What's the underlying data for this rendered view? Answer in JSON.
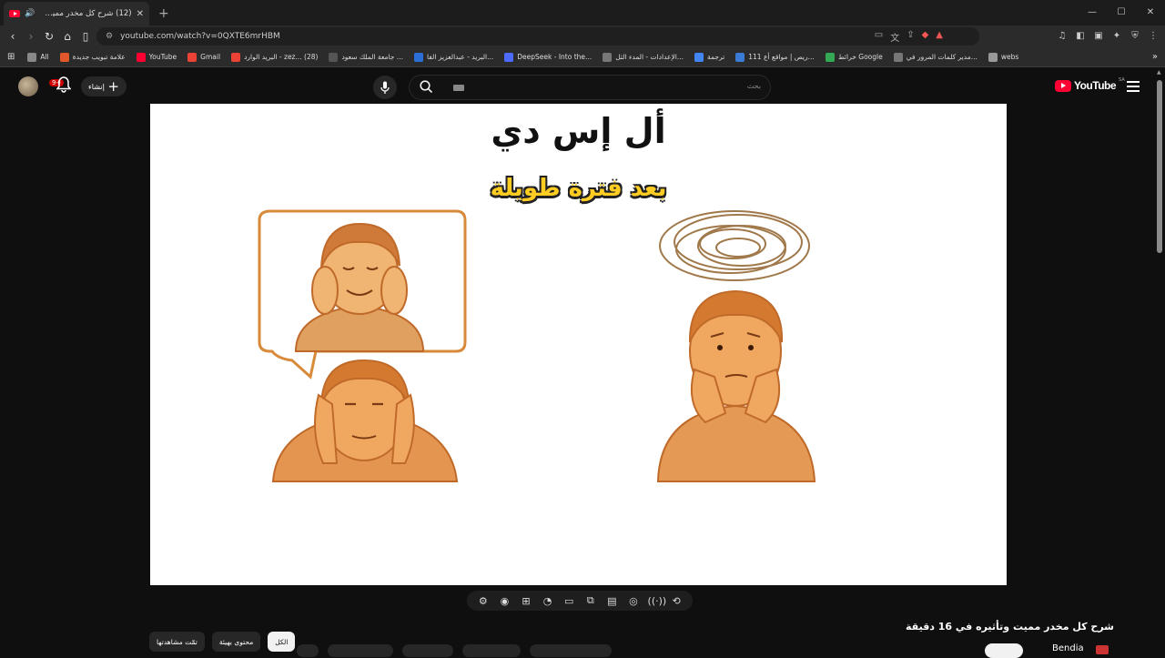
{
  "browser": {
    "tab_title": "(12) شرح كل مخدر مميت وتأثير...",
    "new_tab": "+",
    "url": "youtube.com/watch?v=0QXTE6mrHBM",
    "window_controls": [
      "—",
      "☐",
      "✕"
    ]
  },
  "bookmarks": [
    {
      "label": "All",
      "color": "#888888"
    },
    {
      "label": "علامة تبويب جديدة",
      "color": "#e0572b"
    },
    {
      "label": "YouTube",
      "color": "#ff0033"
    },
    {
      "label": "Gmail",
      "color": "#ea4335"
    },
    {
      "label": "البريد الوارد - zez... (28)",
      "color": "#ea4335"
    },
    {
      "label": "جامعة الملك سعود ...",
      "color": "#555555"
    },
    {
      "label": "البريد - عبدالعزيز الفا...",
      "color": "#2b6fd6"
    },
    {
      "label": "DeepSeek - Into the...",
      "color": "#4d6bfe"
    },
    {
      "label": "الإعدادات - المدء الثل...",
      "color": "#777777"
    },
    {
      "label": "ترجمة",
      "color": "#4285f4"
    },
    {
      "label": "111 ريص | مواقع أع...",
      "color": "#3a7bd5"
    },
    {
      "label": "خرائط Google",
      "color": "#34a853"
    },
    {
      "label": "مدير كلمات المرور في...",
      "color": "#777777"
    },
    {
      "label": "webs",
      "color": "#999999"
    }
  ],
  "youtube": {
    "create_label": "إنشاء",
    "notification_count": "9+",
    "search_placeholder": "بحث",
    "logo_text": "YouTube",
    "logo_region": "SA"
  },
  "video": {
    "title_text": "أل إس دي",
    "subtitle_text": "بعد فترة طويلة",
    "video_title": "شرح كل مخدر مميت وتأثيره في 16 دقيقة",
    "channel": "Bendia"
  },
  "chips": [
    "الكل",
    "محتوى بهيئة",
    "تمّت مشاهدتها"
  ],
  "colors": {
    "accent": "#ff0033",
    "page_bg": "#0f0f0f",
    "subtitle_yellow": "#ffcc22",
    "drawing_orange": "#d88a3a"
  }
}
